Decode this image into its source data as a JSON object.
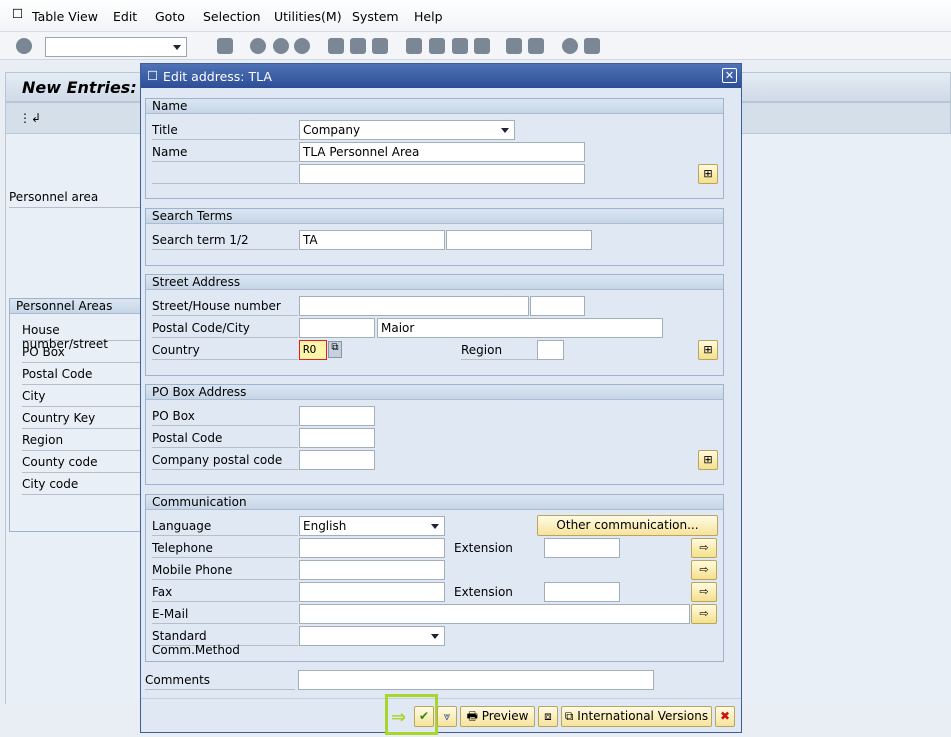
{
  "menu": [
    "Table View",
    "Edit",
    "Goto",
    "Selection",
    "Utilities(M)",
    "System",
    "Help"
  ],
  "background": {
    "title": "New Entries: D",
    "personnel_area_label": "Personnel area",
    "group_title": "Personnel Areas",
    "fields": [
      "House number/street",
      "PO Box",
      "Postal Code",
      "City",
      "Country Key",
      "Region",
      "County code",
      "City code"
    ]
  },
  "dialog": {
    "title": "Edit address:  TLA",
    "name": {
      "header": "Name",
      "title_label": "Title",
      "title_value": "Company",
      "name_label": "Name",
      "name_value": "TLA  Personnel Area",
      "name2_value": ""
    },
    "search": {
      "header": "Search Terms",
      "label": "Search term 1/2",
      "value1": "TA",
      "value2": ""
    },
    "street": {
      "header": "Street Address",
      "street_label": "Street/House number",
      "postal_label": "Postal Code/City",
      "city_value": "Maior",
      "country_label": "Country",
      "country_value": "RO",
      "region_label": "Region"
    },
    "pobox": {
      "header": "PO Box Address",
      "pobox_label": "PO Box",
      "postal_label": "Postal Code",
      "company_postal_label": "Company postal code"
    },
    "comm": {
      "header": "Communication",
      "language_label": "Language",
      "language_value": "English",
      "other_button": "Other communication...",
      "telephone_label": "Telephone",
      "extension_label": "Extension",
      "mobile_label": "Mobile Phone",
      "fax_label": "Fax",
      "fax_extension_label": "Extension",
      "email_label": "E-Mail",
      "std_method_label": "Standard Comm.Method"
    },
    "comments_label": "Comments",
    "buttons": {
      "preview": "Preview",
      "intl": "International Versions"
    }
  }
}
